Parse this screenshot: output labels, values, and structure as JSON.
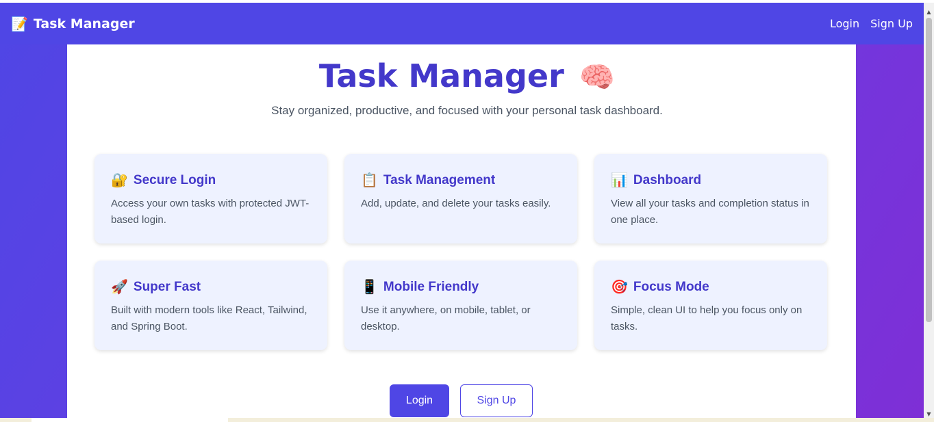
{
  "navbar": {
    "brand_icon": "📝",
    "brand_title": "Task Manager",
    "login_label": "Login",
    "signup_label": "Sign Up"
  },
  "hero": {
    "title": "Task Manager",
    "title_emoji": "🧠",
    "subtitle": "Stay organized, productive, and focused with your personal task dashboard."
  },
  "features": [
    {
      "icon": "🔐",
      "title": "Secure Login",
      "desc": "Access your own tasks with protected JWT-based login."
    },
    {
      "icon": "📋",
      "title": "Task Management",
      "desc": "Add, update, and delete your tasks easily."
    },
    {
      "icon": "📊",
      "title": "Dashboard",
      "desc": "View all your tasks and completion status in one place."
    },
    {
      "icon": "🚀",
      "title": "Super Fast",
      "desc": "Built with modern tools like React, Tailwind, and Spring Boot."
    },
    {
      "icon": "📱",
      "title": "Mobile Friendly",
      "desc": "Use it anywhere, on mobile, tablet, or desktop."
    },
    {
      "icon": "🎯",
      "title": "Focus Mode",
      "desc": "Simple, clean UI to help you focus only on tasks."
    }
  ],
  "cta": {
    "login_label": "Login",
    "signup_label": "Sign Up"
  },
  "colors": {
    "primary": "#4f46e5",
    "heading": "#4338ca",
    "card_bg": "#eef2ff"
  }
}
